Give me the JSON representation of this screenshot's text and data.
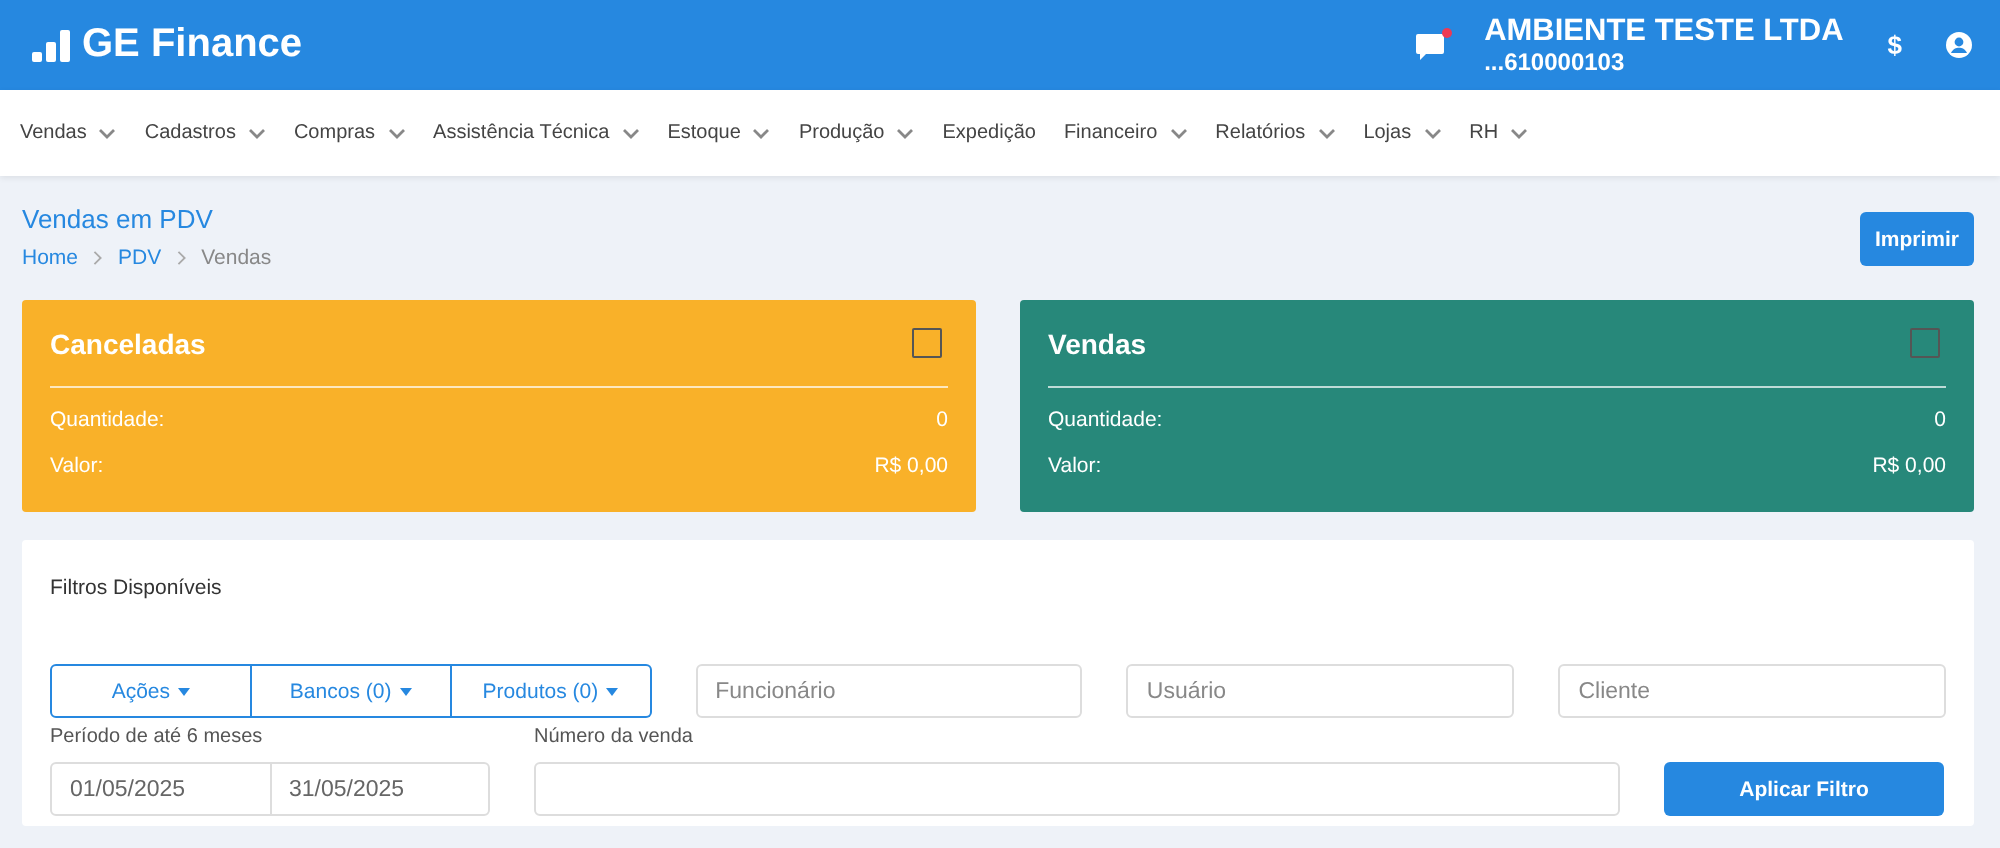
{
  "header": {
    "brand": "GE Finance",
    "notification": true,
    "company": "AMBIENTE TESTE LTDA",
    "account": "...610000103",
    "currency_symbol": "$"
  },
  "menu": [
    {
      "label": "Vendas",
      "dropdown": true
    },
    {
      "label": "Cadastros",
      "dropdown": true
    },
    {
      "label": "Compras",
      "dropdown": true
    },
    {
      "label": "Assistência Técnica",
      "dropdown": true
    },
    {
      "label": "Estoque",
      "dropdown": true
    },
    {
      "label": "Produção",
      "dropdown": true
    },
    {
      "label": "Expedição",
      "dropdown": false
    },
    {
      "label": "Financeiro",
      "dropdown": true
    },
    {
      "label": "Relatórios",
      "dropdown": true
    },
    {
      "label": "Lojas",
      "dropdown": true
    },
    {
      "label": "RH",
      "dropdown": true
    }
  ],
  "page": {
    "title": "Vendas em PDV",
    "breadcrumb": [
      {
        "label": "Home",
        "link": true
      },
      {
        "label": "PDV",
        "link": true
      },
      {
        "label": "Vendas",
        "link": false
      }
    ],
    "print_button": "Imprimir"
  },
  "cards": [
    {
      "title": "Canceladas",
      "color": "#f9b129",
      "checked": false,
      "rows": [
        {
          "label": "Quantidade:",
          "value": "0"
        },
        {
          "label": "Valor:",
          "value": "R$ 0,00"
        }
      ]
    },
    {
      "title": "Vendas",
      "color": "#27887a",
      "checked": false,
      "rows": [
        {
          "label": "Quantidade:",
          "value": "0"
        },
        {
          "label": "Valor:",
          "value": "R$ 0,00"
        }
      ]
    }
  ],
  "filters": {
    "title": "Filtros Disponíveis",
    "dropdowns": [
      "Ações",
      "Bancos (0)",
      "Produtos (0)"
    ],
    "fields": [
      {
        "placeholder": "Funcionário"
      },
      {
        "placeholder": "Usuário"
      },
      {
        "placeholder": "Cliente"
      }
    ],
    "period": {
      "label": "Período de até 6 meses",
      "start": "01/05/2025",
      "end": "31/05/2025"
    },
    "sale_number": {
      "label": "Número da venda"
    },
    "apply_button": "Aplicar Filtro"
  }
}
